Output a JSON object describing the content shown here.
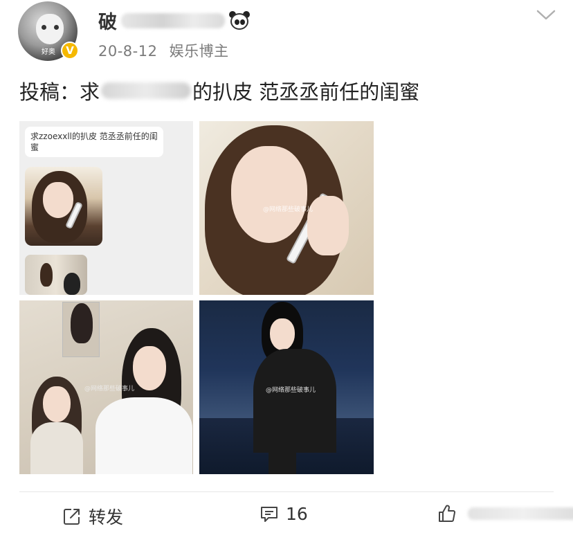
{
  "header": {
    "avatar_watermark": "好奥",
    "username_visible": "破",
    "date": "20-8-12",
    "user_tag": "娱乐博主",
    "verify_mark": "V"
  },
  "post": {
    "text_before": "投稿：求",
    "text_after": "的扒皮 范丞丞前任的闺蜜"
  },
  "images": {
    "chat_message": "求zzoexxll的扒皮 范丞丞前任的闺蜜",
    "watermark": "@网络那些破事儿"
  },
  "actions": {
    "repost_label": "转发",
    "comment_count": "16"
  }
}
